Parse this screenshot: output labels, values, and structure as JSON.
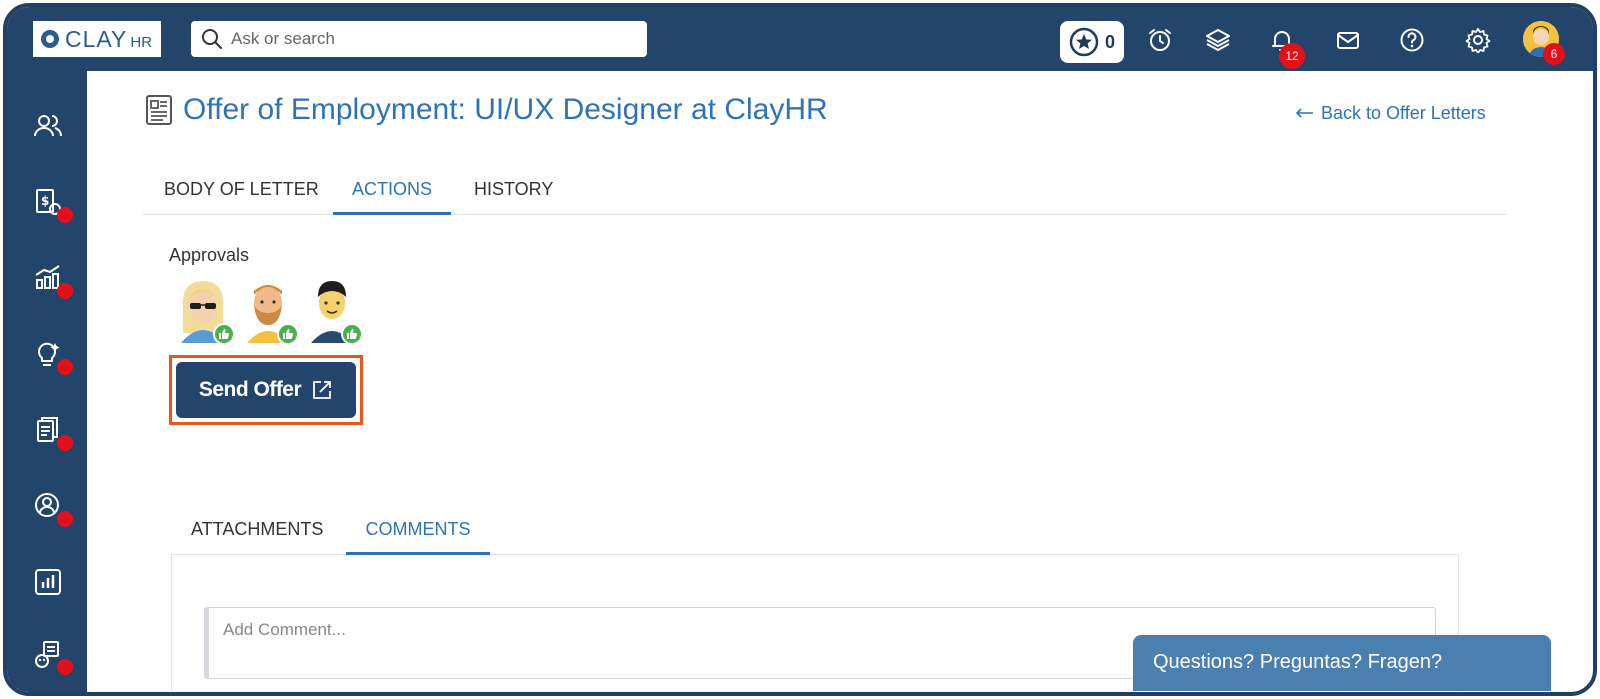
{
  "app": {
    "logo_main": "CLAY",
    "logo_sub": "HR"
  },
  "header": {
    "search_placeholder": "Ask or search",
    "points_count": "0",
    "notifications_count": "12",
    "profile_count": "6",
    "icons": [
      "star-icon",
      "alarm-icon",
      "layers-icon",
      "bell-icon",
      "mail-icon",
      "help-icon",
      "gear-icon"
    ]
  },
  "sidebar": {
    "items": [
      {
        "icon": "people-icon",
        "dot": false
      },
      {
        "icon": "payroll-icon",
        "dot": true
      },
      {
        "icon": "analytics-icon",
        "dot": true
      },
      {
        "icon": "ideas-icon",
        "dot": true
      },
      {
        "icon": "documents-icon",
        "dot": true
      },
      {
        "icon": "profile-icon",
        "dot": true
      },
      {
        "icon": "reports-icon",
        "dot": false
      },
      {
        "icon": "bot-icon",
        "dot": true
      }
    ],
    "dot_color": "#e3101a"
  },
  "page": {
    "title": "Offer of Employment: UI/UX Designer at ClayHR",
    "back_label": "Back to Offer Letters",
    "tabs": [
      "BODY OF LETTER",
      "ACTIONS",
      "HISTORY"
    ],
    "active_tab": "ACTIONS"
  },
  "approvals": {
    "label": "Approvals",
    "approvers": [
      {
        "avatar": "woman-sunglasses-avatar",
        "status": "approved"
      },
      {
        "avatar": "bearded-man-avatar",
        "status": "approved"
      },
      {
        "avatar": "man-dark-hair-avatar",
        "status": "approved"
      }
    ]
  },
  "send_offer": {
    "label": "Send Offer",
    "icon": "external-link-icon"
  },
  "bottom_tabs": [
    "ATTACHMENTS",
    "COMMENTS"
  ],
  "active_bottom_tab": "COMMENTS",
  "comment": {
    "placeholder": "Add Comment..."
  },
  "help_widget": {
    "label": "Questions? Preguntas? Fragen?"
  },
  "colors": {
    "nav_bg": "#24456b",
    "accent": "#2f73b7",
    "highlight": "#e4571f",
    "approve": "#4caf50",
    "badge": "#e3101a"
  }
}
